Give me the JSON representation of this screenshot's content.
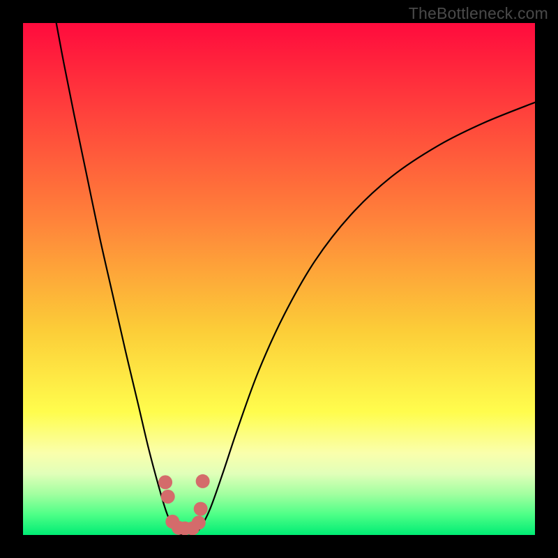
{
  "watermark": "TheBottleneck.com",
  "chart_data": {
    "type": "line",
    "title": "",
    "xlabel": "",
    "ylabel": "",
    "xlim": [
      0,
      100
    ],
    "ylim": [
      0,
      100
    ],
    "grid": false,
    "legend": false,
    "background_gradient": {
      "colors": [
        {
          "stop": 0.0,
          "hex": "#ff0b3d"
        },
        {
          "stop": 0.38,
          "hex": "#ff813a"
        },
        {
          "stop": 0.6,
          "hex": "#fccd38"
        },
        {
          "stop": 0.76,
          "hex": "#fffd4d"
        },
        {
          "stop": 0.84,
          "hex": "#faffac"
        },
        {
          "stop": 0.88,
          "hex": "#e1ffb9"
        },
        {
          "stop": 0.92,
          "hex": "#a2ffa0"
        },
        {
          "stop": 0.96,
          "hex": "#4eff87"
        },
        {
          "stop": 1.0,
          "hex": "#00ec74"
        }
      ]
    },
    "series": [
      {
        "name": "bottleneck-curve",
        "stroke": "#000000",
        "stroke_width": 2.2,
        "points": [
          {
            "x": 6.5,
            "y": 100.0
          },
          {
            "x": 8.0,
            "y": 92.0
          },
          {
            "x": 10.0,
            "y": 82.0
          },
          {
            "x": 12.5,
            "y": 70.0
          },
          {
            "x": 15.0,
            "y": 58.0
          },
          {
            "x": 17.5,
            "y": 47.0
          },
          {
            "x": 20.0,
            "y": 36.0
          },
          {
            "x": 22.5,
            "y": 25.5
          },
          {
            "x": 24.5,
            "y": 17.0
          },
          {
            "x": 26.5,
            "y": 9.5
          },
          {
            "x": 28.0,
            "y": 4.5
          },
          {
            "x": 29.5,
            "y": 1.2
          },
          {
            "x": 31.0,
            "y": 0.0
          },
          {
            "x": 33.0,
            "y": 0.0
          },
          {
            "x": 34.5,
            "y": 1.2
          },
          {
            "x": 36.5,
            "y": 5.0
          },
          {
            "x": 39.0,
            "y": 12.0
          },
          {
            "x": 42.0,
            "y": 21.0
          },
          {
            "x": 46.0,
            "y": 32.0
          },
          {
            "x": 51.0,
            "y": 43.0
          },
          {
            "x": 57.0,
            "y": 53.5
          },
          {
            "x": 64.0,
            "y": 62.5
          },
          {
            "x": 72.0,
            "y": 70.0
          },
          {
            "x": 81.0,
            "y": 76.0
          },
          {
            "x": 90.0,
            "y": 80.5
          },
          {
            "x": 100.0,
            "y": 84.5
          }
        ]
      },
      {
        "name": "highlight-markers",
        "stroke": "#d46b6b",
        "marker": "circle",
        "marker_radius": 10,
        "points": [
          {
            "x": 27.8,
            "y": 10.3
          },
          {
            "x": 28.3,
            "y": 7.5
          },
          {
            "x": 29.2,
            "y": 2.6
          },
          {
            "x": 30.4,
            "y": 1.4
          },
          {
            "x": 31.6,
            "y": 1.3
          },
          {
            "x": 33.1,
            "y": 1.3
          },
          {
            "x": 34.3,
            "y": 2.4
          },
          {
            "x": 34.7,
            "y": 5.1
          },
          {
            "x": 35.1,
            "y": 10.5
          }
        ]
      }
    ]
  }
}
